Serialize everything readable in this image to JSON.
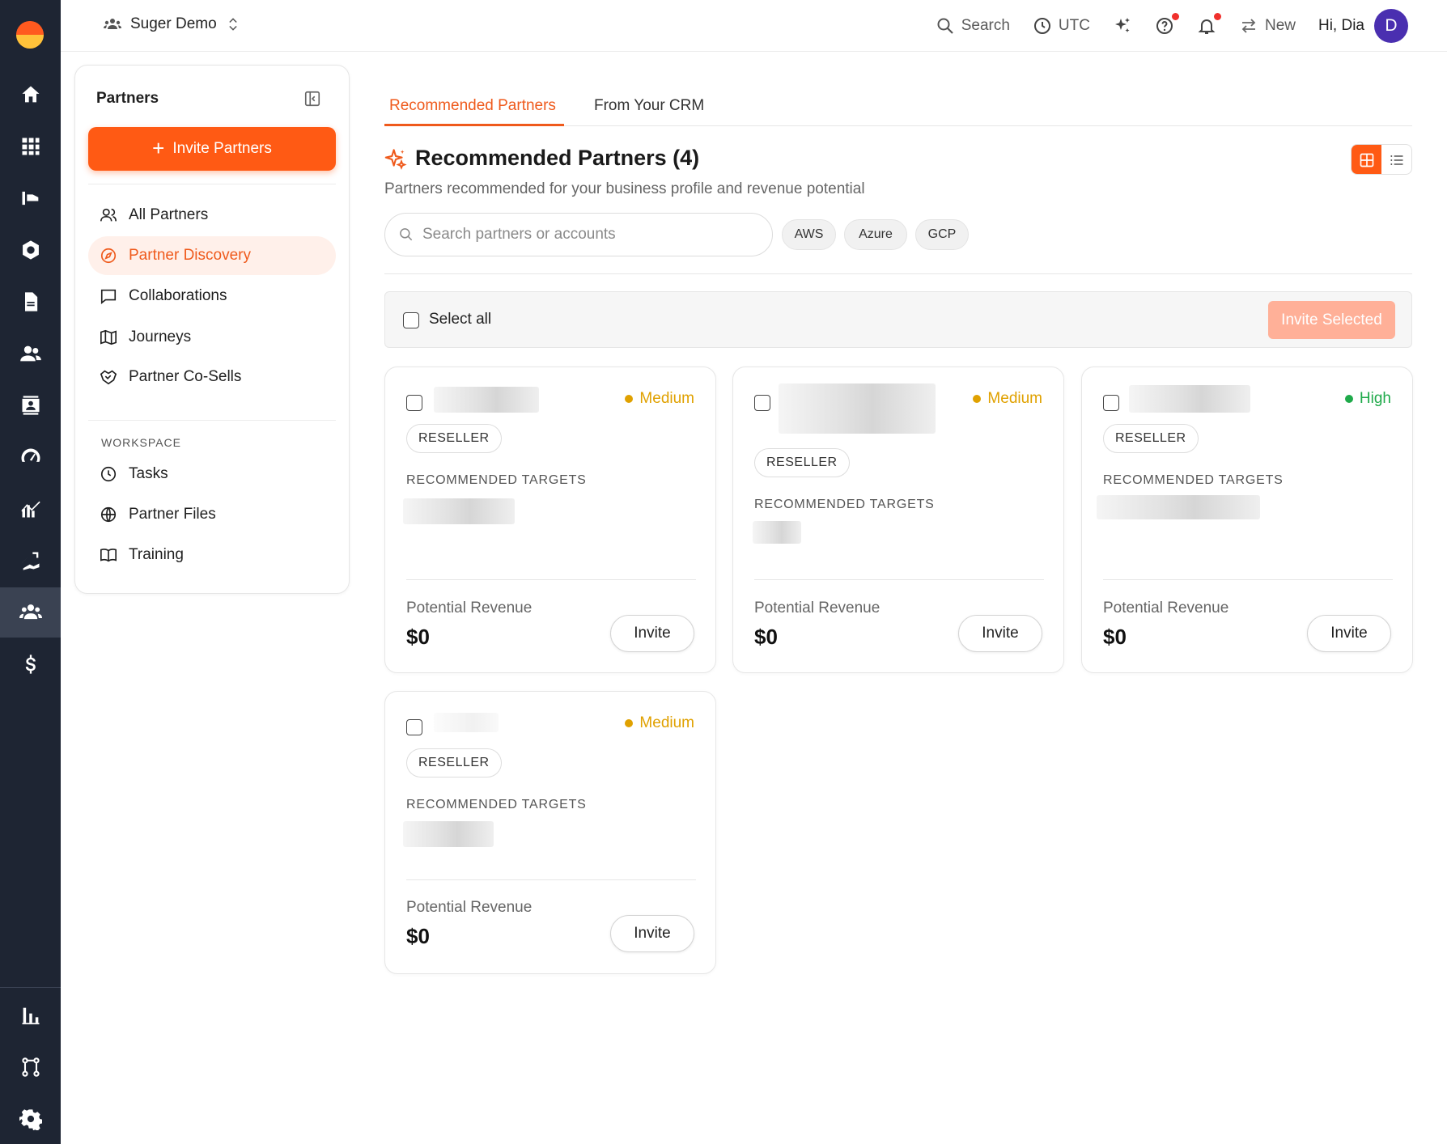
{
  "app": {
    "org_name": "Suger Demo",
    "colors": {
      "accent": "#ff5a14",
      "rail": "#1e2533",
      "medium": "#e0a100",
      "high": "#1faa4a"
    }
  },
  "topbar": {
    "search_label": "Search",
    "timezone_label": "UTC",
    "new_label": "New",
    "greeting": "Hi, Dia",
    "avatar_initial": "D"
  },
  "rail": {
    "icons": [
      "home-icon",
      "apps-grid-icon",
      "marketplace-icon",
      "settings-hex-icon",
      "document-icon",
      "customers-icon",
      "contacts-icon",
      "gauge-icon",
      "analytics-icon",
      "integrations-icon",
      "partners-icon",
      "billing-icon",
      "reports-icon",
      "workflow-icon",
      "settings-icon"
    ],
    "active": "partners-icon"
  },
  "sidebar": {
    "title": "Partners",
    "invite_button": "Invite Partners",
    "items": [
      {
        "label": "All Partners",
        "icon": "users-icon"
      },
      {
        "label": "Partner Discovery",
        "icon": "compass-icon",
        "active": true
      },
      {
        "label": "Collaborations",
        "icon": "chat-icon"
      },
      {
        "label": "Journeys",
        "icon": "map-icon"
      },
      {
        "label": "Partner Co-Sells",
        "icon": "handshake-icon"
      }
    ],
    "workspace_label": "WORKSPACE",
    "workspace_items": [
      {
        "label": "Tasks",
        "icon": "clock-icon"
      },
      {
        "label": "Partner Files",
        "icon": "globe-icon"
      },
      {
        "label": "Training",
        "icon": "book-icon"
      }
    ]
  },
  "main": {
    "tabs": [
      {
        "label": "Recommended Partners",
        "active": true
      },
      {
        "label": "From Your CRM"
      }
    ],
    "title": "Recommended Partners (4)",
    "subtitle": "Partners recommended for your business profile and revenue potential",
    "search_placeholder": "Search partners or accounts",
    "filters": [
      "AWS",
      "Azure",
      "GCP"
    ],
    "select_all": "Select all",
    "invite_selected": "Invite Selected",
    "view_modes": [
      "grid-view-icon",
      "list-view-icon"
    ]
  },
  "cards": [
    {
      "priority": "Medium",
      "type": "RESELLER",
      "targets_label": "RECOMMENDED TARGETS",
      "revenue_label": "Potential Revenue",
      "revenue": "$0",
      "invite": "Invite"
    },
    {
      "priority": "Medium",
      "type": "RESELLER",
      "targets_label": "RECOMMENDED TARGETS",
      "revenue_label": "Potential Revenue",
      "revenue": "$0",
      "invite": "Invite"
    },
    {
      "priority": "High",
      "type": "RESELLER",
      "targets_label": "RECOMMENDED TARGETS",
      "revenue_label": "Potential Revenue",
      "revenue": "$0",
      "invite": "Invite"
    },
    {
      "priority": "Medium",
      "type": "RESELLER",
      "targets_label": "RECOMMENDED TARGETS",
      "revenue_label": "Potential Revenue",
      "revenue": "$0",
      "invite": "Invite"
    }
  ]
}
